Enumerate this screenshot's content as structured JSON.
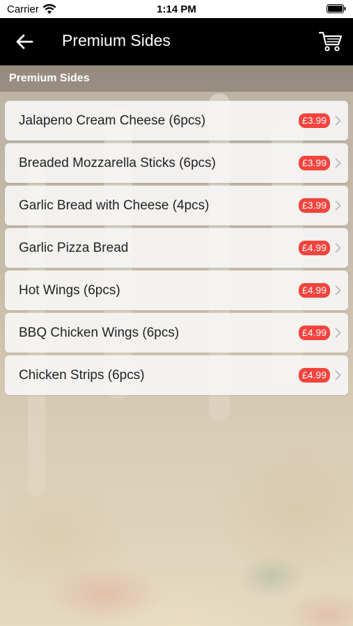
{
  "status_bar": {
    "carrier": "Carrier",
    "time": "1:14 PM"
  },
  "nav": {
    "title": "Premium Sides"
  },
  "section": {
    "header": "Premium Sides"
  },
  "items": [
    {
      "name": "Jalapeno Cream Cheese (6pcs)",
      "price": "£3.99"
    },
    {
      "name": "Breaded Mozzarella Sticks (6pcs)",
      "price": "£3.99"
    },
    {
      "name": "Garlic Bread with Cheese (4pcs)",
      "price": "£3.99"
    },
    {
      "name": "Garlic Pizza Bread",
      "price": "£4.99"
    },
    {
      "name": "Hot Wings (6pcs)",
      "price": "£4.99"
    },
    {
      "name": "BBQ Chicken Wings (6pcs)",
      "price": "£4.99"
    },
    {
      "name": "Chicken Strips (6pcs)",
      "price": "£4.99"
    }
  ],
  "colors": {
    "nav_bg": "#000000",
    "price_badge": "#f3433d",
    "text": "#222222"
  },
  "icons": {
    "back": "arrow-left-icon",
    "cart": "cart-icon",
    "row": "chevron-right-icon"
  }
}
